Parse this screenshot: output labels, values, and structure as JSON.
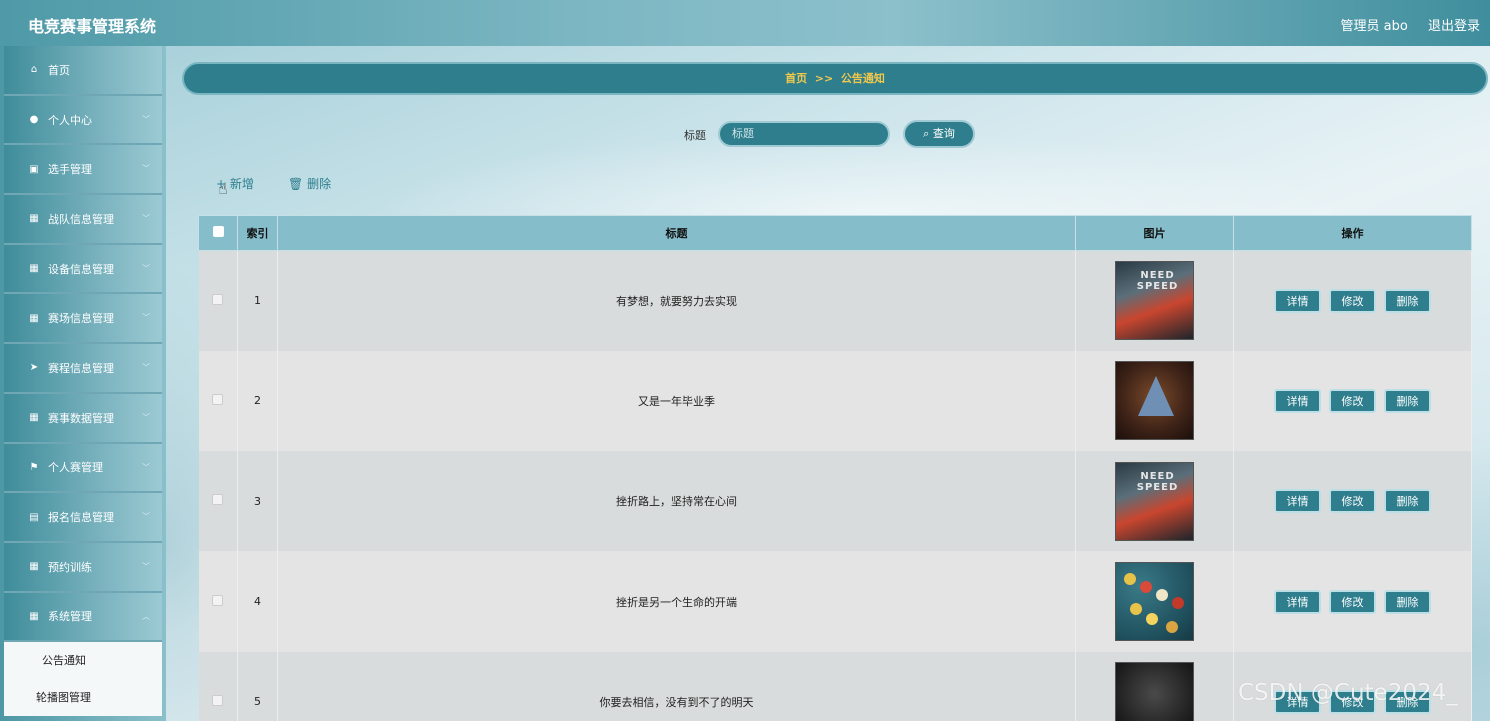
{
  "app": {
    "title": "电竞赛事管理系统"
  },
  "header": {
    "user_label": "管理员 abo",
    "logout_label": "退出登录"
  },
  "sidebar": {
    "items": [
      {
        "label": "首页",
        "icon": "home-icon",
        "glyph": "⌂",
        "has_children": false
      },
      {
        "label": "个人中心",
        "icon": "user-icon",
        "glyph": "●",
        "has_children": true
      },
      {
        "label": "选手管理",
        "icon": "clipboard-icon",
        "glyph": "▣",
        "has_children": true
      },
      {
        "label": "战队信息管理",
        "icon": "grid-icon",
        "glyph": "▦",
        "has_children": true
      },
      {
        "label": "设备信息管理",
        "icon": "grid-icon",
        "glyph": "▦",
        "has_children": true
      },
      {
        "label": "赛场信息管理",
        "icon": "grid-icon",
        "glyph": "▦",
        "has_children": true
      },
      {
        "label": "赛程信息管理",
        "icon": "send-icon",
        "glyph": "➤",
        "has_children": true
      },
      {
        "label": "赛事数据管理",
        "icon": "grid-icon",
        "glyph": "▦",
        "has_children": true
      },
      {
        "label": "个人赛管理",
        "icon": "flag-icon",
        "glyph": "⚑",
        "has_children": true
      },
      {
        "label": "报名信息管理",
        "icon": "briefcase-icon",
        "glyph": "▤",
        "has_children": true
      },
      {
        "label": "预约训练",
        "icon": "grid-icon",
        "glyph": "▦",
        "has_children": true
      },
      {
        "label": "系统管理",
        "icon": "grid-icon",
        "glyph": "▦",
        "has_children": true
      }
    ],
    "submenu": [
      {
        "label": "公告通知"
      },
      {
        "label": "轮播图管理"
      }
    ]
  },
  "breadcrumb": {
    "home": "首页",
    "separator": ">>",
    "current": "公告通知"
  },
  "search": {
    "label": "标题",
    "placeholder": "标题",
    "button_label": "查询",
    "button_icon": "search-icon"
  },
  "actions": {
    "add_label": "新增",
    "add_icon": "plus-icon",
    "delete_label": "删除",
    "delete_icon": "trash-icon"
  },
  "table": {
    "columns": [
      "",
      "索引",
      "标题",
      "图片",
      "操作"
    ],
    "rows": [
      {
        "index": "1",
        "title": "有梦想，就要努力去实现",
        "image": "racing-car-thumbnail"
      },
      {
        "index": "2",
        "title": "又是一年毕业季",
        "image": "triangle-logo-thumbnail"
      },
      {
        "index": "3",
        "title": "挫折路上，坚持常在心间",
        "image": "racing-car-thumbnail"
      },
      {
        "index": "4",
        "title": "挫折是另一个生命的开端",
        "image": "billiard-balls-thumbnail"
      },
      {
        "index": "5",
        "title": "你要去相信，没有到不了的明天",
        "image": "dark-object-thumbnail"
      }
    ],
    "row_actions": {
      "detail": "详情",
      "edit": "修改",
      "delete": "删除"
    }
  },
  "watermark": "CSDN @Cute2024_",
  "colors": {
    "primary": "#2e7e8d",
    "breadcrumb_text": "#f2c94c",
    "header_bg": "#85bdca"
  }
}
